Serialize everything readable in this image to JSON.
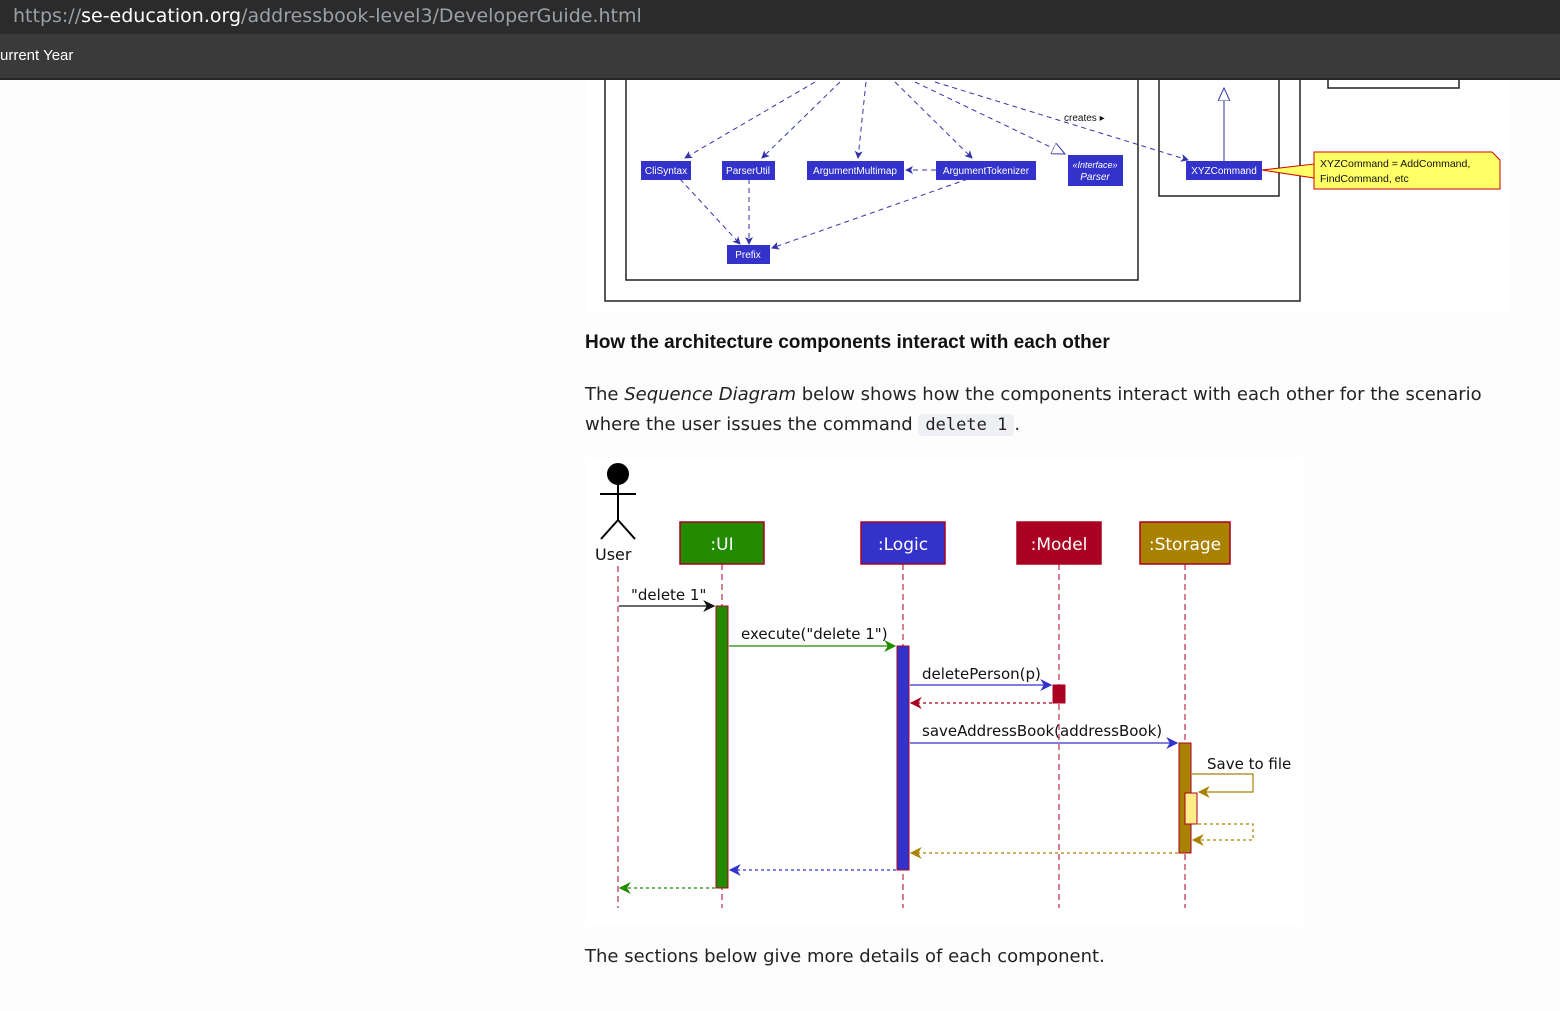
{
  "browser": {
    "url_scheme": "https://",
    "url_host": "se-education.org",
    "url_path": "/addressbook-level3/DeveloperGuide.html"
  },
  "navbar": {
    "item_current_year": "urrent Year"
  },
  "class_diagram": {
    "creates_label": "creates ▸",
    "classes": {
      "clisyntax": "CliSyntax",
      "parserutil": "ParserUtil",
      "argumentmultimap": "ArgumentMultimap",
      "argumenttokenizer": "ArgumentTokenizer",
      "parser_stereotype": "«Interface»",
      "parser": "Parser",
      "xyzcommand": "XYZCommand",
      "prefix": "Prefix"
    },
    "note_line1": "XYZCommand = AddCommand,",
    "note_line2": "FindCommand, etc",
    "colors": {
      "class_fill": "#3333cc",
      "note_fill": "#ffff66",
      "note_border": "#cc0000"
    }
  },
  "section": {
    "heading": "How the architecture components interact with each other",
    "para_prefix": "The ",
    "para_em": "Sequence Diagram",
    "para_mid": " below shows how the components interact with each other for the scenario where the user issues the command ",
    "para_code": "delete 1",
    "para_suffix": ".",
    "para2": "The sections below give more details of each component."
  },
  "sequence_diagram": {
    "actor": "User",
    "participants": {
      "ui": ":UI",
      "logic": ":Logic",
      "model": ":Model",
      "storage": ":Storage"
    },
    "messages": {
      "delete": "\"delete 1\"",
      "execute": "execute(\"delete 1\")",
      "delete_person": "deletePerson(p)",
      "save_address_book": "saveAddressBook(addressBook)",
      "save_to_file": "Save to file"
    },
    "colors": {
      "ui": "#228b00",
      "logic": "#3333cc",
      "model": "#aa0022",
      "storage": "#a88200",
      "lifeline": "#aa0022",
      "self_box": "#ffee88"
    }
  }
}
